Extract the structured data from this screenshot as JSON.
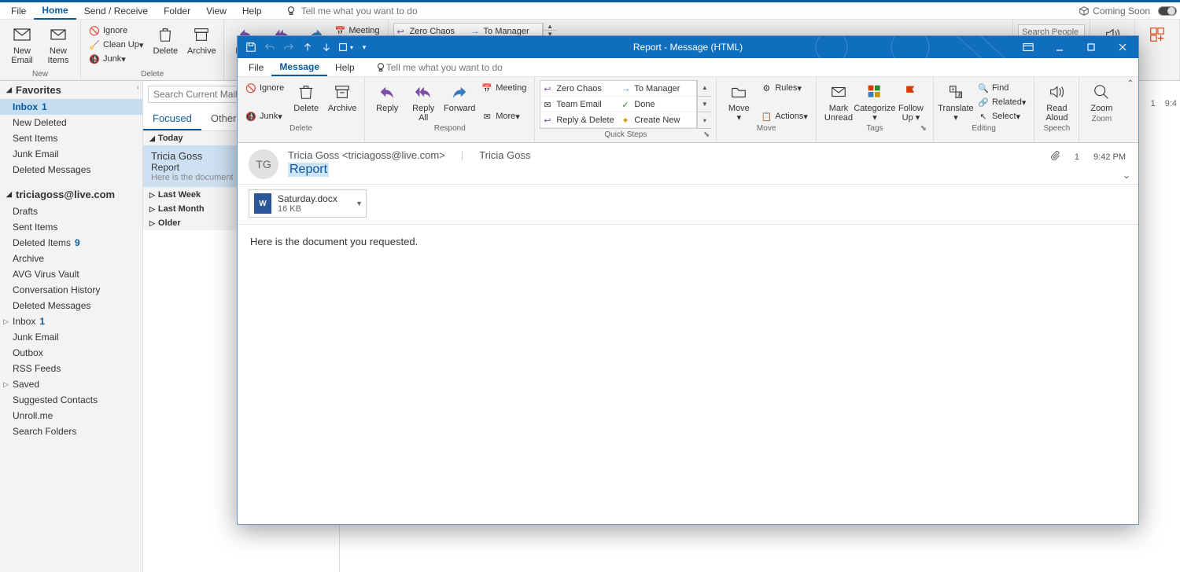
{
  "menu": {
    "tabs": [
      "File",
      "Home",
      "Send / Receive",
      "Folder",
      "View",
      "Help"
    ],
    "active": "Home",
    "tell_me": "Tell me what you want to do",
    "coming_soon": "Coming Soon"
  },
  "ribbon": {
    "new_group": {
      "new_email": "New\nEmail",
      "new_items": "New\nItems",
      "label": "New"
    },
    "delete_group": {
      "ignore": "Ignore",
      "clean_up": "Clean Up",
      "junk": "Junk",
      "delete": "Delete",
      "archive": "Archive",
      "label": "Delete"
    },
    "respond_group": {
      "reply": "Reply",
      "reply_all": "Reply\nAll",
      "meeting": "Meeting"
    },
    "quick_steps": {
      "zero_chaos": "Zero Chaos",
      "to_manager": "To Manager"
    },
    "search_placeholder": "Search People"
  },
  "nav": {
    "favorites": "Favorites",
    "fav_items": [
      {
        "label": "Inbox",
        "count": "1",
        "bold": true
      },
      {
        "label": "New Deleted"
      },
      {
        "label": "Sent Items"
      },
      {
        "label": "Junk Email"
      },
      {
        "label": "Deleted Messages"
      }
    ],
    "account": "triciagoss@live.com",
    "account_items": [
      {
        "label": "Drafts"
      },
      {
        "label": "Sent Items"
      },
      {
        "label": "Deleted Items",
        "count": "9"
      },
      {
        "label": "Archive"
      },
      {
        "label": "AVG Virus Vault"
      },
      {
        "label": "Conversation History"
      },
      {
        "label": "Deleted Messages"
      },
      {
        "label": "Inbox",
        "count": "1",
        "caret": true
      },
      {
        "label": "Junk Email"
      },
      {
        "label": "Outbox"
      },
      {
        "label": "RSS Feeds"
      },
      {
        "label": "Saved",
        "caret": true
      },
      {
        "label": "Suggested Contacts"
      },
      {
        "label": "Unroll.me"
      },
      {
        "label": "Search Folders"
      }
    ]
  },
  "list": {
    "search_placeholder": "Search Current Mailbox",
    "tabs": {
      "focused": "Focused",
      "other": "Other"
    },
    "today": "Today",
    "msg": {
      "from": "Tricia Goss",
      "subject": "Report",
      "preview": "Here is the document"
    },
    "groups": [
      "Last Week",
      "Last Month",
      "Older"
    ]
  },
  "modal": {
    "title": "Report  -  Message (HTML)",
    "tabs": [
      "File",
      "Message",
      "Help"
    ],
    "active_tab": "Message",
    "tell_me": "Tell me what you want to do",
    "groups": {
      "delete": {
        "ignore": "Ignore",
        "junk": "Junk",
        "delete": "Delete",
        "archive": "Archive",
        "label": "Delete"
      },
      "respond": {
        "reply": "Reply",
        "reply_all": "Reply\nAll",
        "forward": "Forward",
        "meeting": "Meeting",
        "more": "More",
        "label": "Respond"
      },
      "quick_steps": {
        "zero_chaos": "Zero Chaos",
        "to_manager": "To Manager",
        "team_email": "Team Email",
        "done": "Done",
        "reply_delete": "Reply & Delete",
        "create_new": "Create New",
        "label": "Quick Steps"
      },
      "move": {
        "move": "Move",
        "rules": "Rules",
        "actions": "Actions",
        "label": "Move"
      },
      "tags": {
        "mark_unread": "Mark\nUnread",
        "categorize": "Categorize",
        "follow_up": "Follow\nUp",
        "label": "Tags"
      },
      "editing": {
        "translate": "Translate",
        "find": "Find",
        "related": "Related",
        "select": "Select",
        "label": "Editing"
      },
      "speech": {
        "read_aloud": "Read\nAloud",
        "label": "Speech"
      },
      "zoom": {
        "zoom": "Zoom",
        "label": "Zoom"
      }
    },
    "header": {
      "avatar": "TG",
      "from_line": "Tricia Goss <triciagoss@live.com>",
      "to_name": "Tricia Goss",
      "subject": "Report",
      "attach_count": "1",
      "time": "9:42 PM"
    },
    "attachment": {
      "name": "Saturday.docx",
      "size": "16 KB"
    },
    "body": "Here is the document you requested."
  },
  "status": {
    "count": "1",
    "time": "9:4"
  }
}
